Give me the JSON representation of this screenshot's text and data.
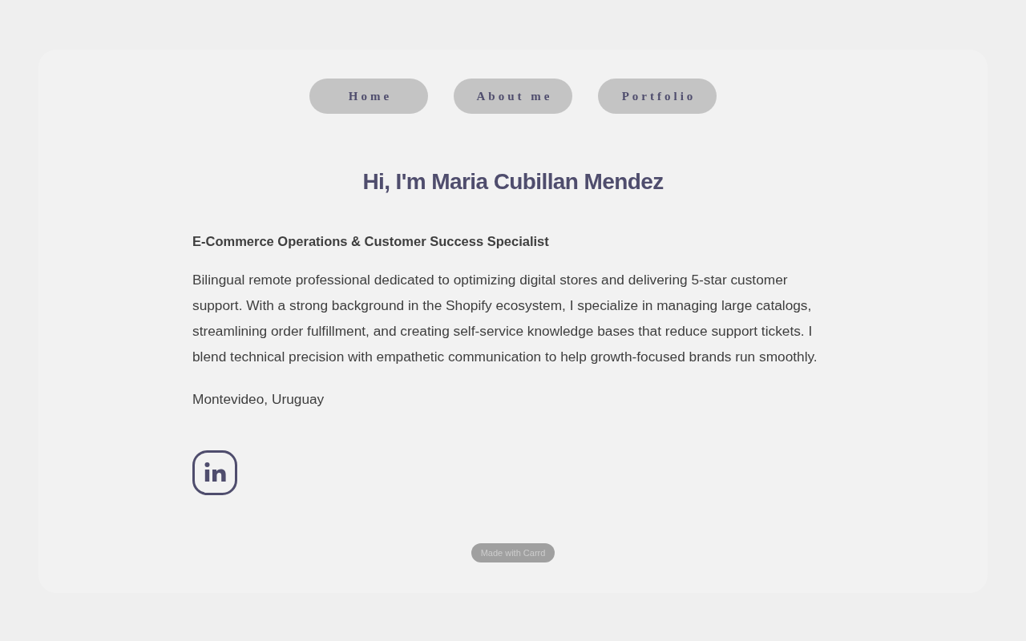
{
  "nav": [
    {
      "label": "Home"
    },
    {
      "label": "About me"
    },
    {
      "label": "Portfolio"
    }
  ],
  "heading": "Hi, I'm Maria Cubillan Mendez",
  "subtitle": "E-Commerce Operations & Customer Success Specialist",
  "bio": "Bilingual remote professional dedicated to optimizing digital stores and delivering 5-star customer support. With a strong background in the Shopify ecosystem, I specialize in managing large catalogs, streamlining order fulfillment, and creating self-service knowledge bases that reduce support tickets. I blend technical precision with empathetic communication to help growth-focused brands run smoothly.",
  "location": "Montevideo, Uruguay",
  "footer_badge": "Made with Carrd"
}
